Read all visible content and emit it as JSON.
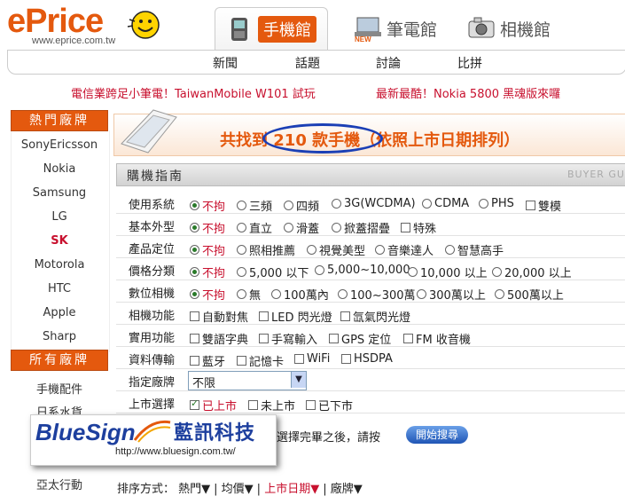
{
  "header": {
    "logo_e": "e",
    "logo_price": "Price",
    "logo_url": "www.eprice.com.tw",
    "tabs": [
      {
        "label": "手機館"
      },
      {
        "label": "筆電館"
      },
      {
        "label": "相機館"
      }
    ],
    "nav": [
      "新聞",
      "話題",
      "討論",
      "比拼"
    ],
    "news": [
      "電信業跨足小筆電！TaiwanMobile W101 試玩",
      "最新最酷！Nokia 5800 黑魂版來囉"
    ]
  },
  "sidebar": {
    "hot_title": "熱門廠牌",
    "hot_brands": [
      "SonyEricsson",
      "Nokia",
      "Samsung",
      "LG",
      "SK",
      "Motorola",
      "HTC",
      "Apple",
      "Sharp"
    ],
    "active_brand": "SK",
    "all_title": "所有廠牌",
    "all_items": [
      "手機配件",
      "日系水貨",
      "亞太行動"
    ]
  },
  "result": {
    "prefix": "共找到",
    "count": "210",
    "suffix": "款手機（依照上市日期排列）"
  },
  "guide": {
    "title": "購機指南",
    "watermark": "BUYER GU",
    "rows": [
      {
        "label": "使用系統",
        "type": "radio",
        "options": [
          "不拘",
          "三頻",
          "四頻",
          "3G(WCDMA)",
          "CDMA",
          "PHS"
        ],
        "extra_check": "雙模",
        "selected": 0
      },
      {
        "label": "基本外型",
        "type": "radio",
        "options": [
          "不拘",
          "直立",
          "滑蓋",
          "掀蓋摺疊"
        ],
        "extra_check": "特殊",
        "selected": 0
      },
      {
        "label": "產品定位",
        "type": "radio",
        "options": [
          "不拘",
          "照相推薦",
          "視覺美型",
          "音樂達人",
          "智慧高手"
        ],
        "selected": 0
      },
      {
        "label": "價格分類",
        "type": "radio",
        "options": [
          "不拘",
          "5,000 以下",
          "5,000~10,000",
          "10,000 以上",
          "20,000 以上"
        ],
        "selected": 0
      },
      {
        "label": "數位相機",
        "type": "radio",
        "options": [
          "不拘",
          "無",
          "100萬內",
          "100~300萬",
          "300萬以上",
          "500萬以上"
        ],
        "selected": 0
      },
      {
        "label": "相機功能",
        "type": "check",
        "options": [
          "自動對焦",
          "LED 閃光燈",
          "氙氣閃光燈"
        ]
      },
      {
        "label": "實用功能",
        "type": "check",
        "options": [
          "雙語字典",
          "手寫輸入",
          "GPS 定位",
          "FM 收音機"
        ]
      },
      {
        "label": "資料傳輸",
        "type": "check",
        "options": [
          "藍牙",
          "記憶卡",
          "WiFi",
          "HSDPA"
        ]
      },
      {
        "label": "指定廠牌",
        "type": "select",
        "value": "不限"
      },
      {
        "label": "上市選擇",
        "type": "check",
        "options": [
          "已上市",
          "未上市",
          "已下市"
        ],
        "checked": [
          0
        ]
      }
    ],
    "hint": "選擇完畢之後，請按",
    "search_button": "開始搜尋"
  },
  "watermark": {
    "logo": "BlueSign",
    "cn": "藍訊科技",
    "url": "http://www.bluesign.com.tw/"
  },
  "sort": {
    "label": "排序方式：",
    "items": [
      "熱門▼",
      "均價▼",
      "上市日期▼",
      "廠牌▼"
    ],
    "active": "上市日期▼"
  }
}
